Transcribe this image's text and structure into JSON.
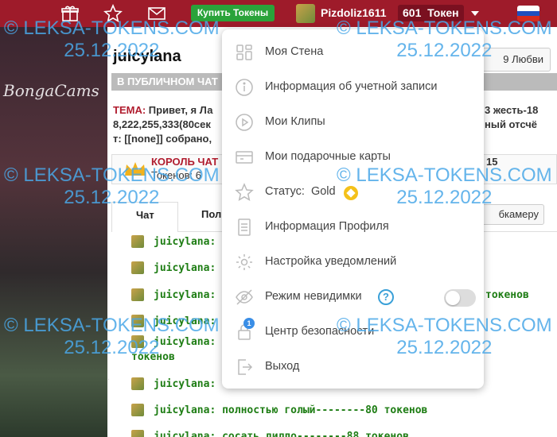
{
  "topbar": {
    "icons": [
      "gift-icon",
      "star-icon",
      "mail-icon"
    ],
    "buy_tokens": "Купить Токены",
    "username": "Pizdoliz1611",
    "token_count": "601",
    "token_word": "Токен",
    "bg_color": "#9e1b2a",
    "buy_color": "#2aa33a"
  },
  "sidebar": {
    "logo": "BongaCams"
  },
  "model": {
    "name": "juicylana",
    "love_button": "9 Любви"
  },
  "public_chat": "В ПУБЛИЧНОМ ЧАТ",
  "topic": {
    "label": "ТЕМА:",
    "line1": " Привет, я Ла",
    "line2": "8,222,255,333(80сек",
    "line3": "т: [[none]] собрано,",
    "right1": "3 жесть-18",
    "right2": "ный отсчё"
  },
  "king": {
    "label": "КОРОЛЬ ЧАТ",
    "sub": "Токенов: 6",
    "value": "15"
  },
  "tabs": {
    "chat": "Чат",
    "other": "Пол",
    "camera_button": "бкамеру"
  },
  "chat_messages": [
    {
      "text": "juicylana:"
    },
    {
      "text": "juicylana:"
    },
    {
      "text": "juicylana:",
      "tail": "токенов"
    },
    {
      "text": "juicylana:"
    },
    {
      "text": "juicylana:"
    },
    {
      "text": "токенов"
    },
    {
      "text": "juicylana:"
    },
    {
      "text": "juicylana: полностью голый--------80 токенов"
    },
    {
      "text": "juicylana: сосать дилдо--------88 токенов"
    }
  ],
  "menu": {
    "items": [
      {
        "icon": "wall-icon",
        "label": "Моя Стена"
      },
      {
        "icon": "info-icon",
        "label": "Информация об учетной записи"
      },
      {
        "icon": "play-icon",
        "label": "Мои Клипы"
      },
      {
        "icon": "gift-card-icon",
        "label": "Мои подарочные карты"
      },
      {
        "icon": "star-icon",
        "label": "Статус:",
        "value": "Gold"
      },
      {
        "icon": "document-icon",
        "label": "Информация Профиля"
      },
      {
        "icon": "gear-icon",
        "label": "Настройка уведомлений"
      },
      {
        "icon": "eye-off-icon",
        "label": "Режим невидимки",
        "help": "?",
        "toggle": false
      },
      {
        "icon": "lock-icon",
        "label": "Центр безопасности",
        "badge": "1"
      },
      {
        "icon": "logout-icon",
        "label": "Выход"
      }
    ]
  },
  "watermark": {
    "site": "© LEKSA-TOKENS.COM",
    "date": "25.12.2022",
    "color": "#4aa8e8"
  }
}
